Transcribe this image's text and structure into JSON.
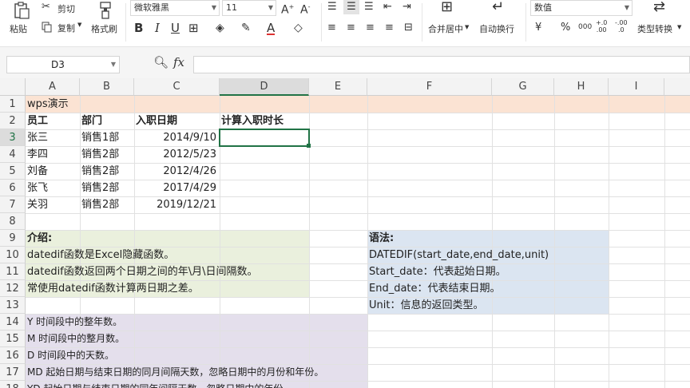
{
  "ribbon": {
    "paste_label": "粘贴",
    "cut_label": "剪切",
    "copy_label": "复制",
    "format_painter_label": "格式刷",
    "font_name": "微软雅黑",
    "font_size": "11",
    "merge_label": "合并居中",
    "wrap_label": "自动换行",
    "number_format": "数值",
    "convert_label": "类型转换",
    "currency_symbol": "¥",
    "percent_symbol": "%",
    "thousands_symbol": "000",
    "inc_decimal": "+.0\n.00",
    "dec_decimal": "-.00\n.0"
  },
  "formula_bar": {
    "name_box": "D3",
    "fx_label": "fx",
    "formula": ""
  },
  "columns": [
    "A",
    "B",
    "C",
    "D",
    "E",
    "F",
    "G",
    "H",
    "I"
  ],
  "rows": [
    "1",
    "2",
    "3",
    "4",
    "5",
    "6",
    "7",
    "8",
    "9",
    "10",
    "11",
    "12",
    "13",
    "14",
    "15",
    "16",
    "17",
    "18"
  ],
  "cells": {
    "a1": "wps演示",
    "a2": "员工",
    "b2": "部门",
    "c2": "入职日期",
    "d2": "计算入职时长",
    "a3": "张三",
    "b3": "销售1部",
    "c3": "2014/9/10",
    "a4": "李四",
    "b4": "销售2部",
    "c4": "2012/5/23",
    "a5": "刘备",
    "b5": "销售2部",
    "c5": "2012/4/26",
    "a6": "张飞",
    "b6": "销售2部",
    "c6": "2017/4/29",
    "a7": "关羽",
    "b7": "销售2部",
    "c7": "2019/12/21",
    "a9": "介绍:",
    "a10": "datedif函数是Excel隐藏函数。",
    "a11": "datedif函数返回两个日期之间的年\\月\\日间隔数。",
    "a12": "常使用datedif函数计算两日期之差。",
    "f9": "语法:",
    "f10": "DATEDIF(start_date,end_date,unit)",
    "f11": "Start_date：代表起始日期。",
    "f12": "End_date：代表结束日期。",
    "f13": "Unit：信息的返回类型。",
    "a14": "Y 时间段中的整年数。",
    "a15": "M 时间段中的整月数。",
    "a16": "D 时间段中的天数。",
    "a17": "MD 起始日期与结束日期的同月间隔天数，忽略日期中的月份和年份。",
    "a18": "YD 起始日期与结束日期的同年间隔天数，忽略日期中的年份。"
  },
  "colors": {
    "row1_fill": "#fbe3d3",
    "intro_fill": "#eaf0dd",
    "syntax_fill": "#dbe5f1",
    "units_fill": "#e4dfec",
    "selection": "#217346"
  }
}
